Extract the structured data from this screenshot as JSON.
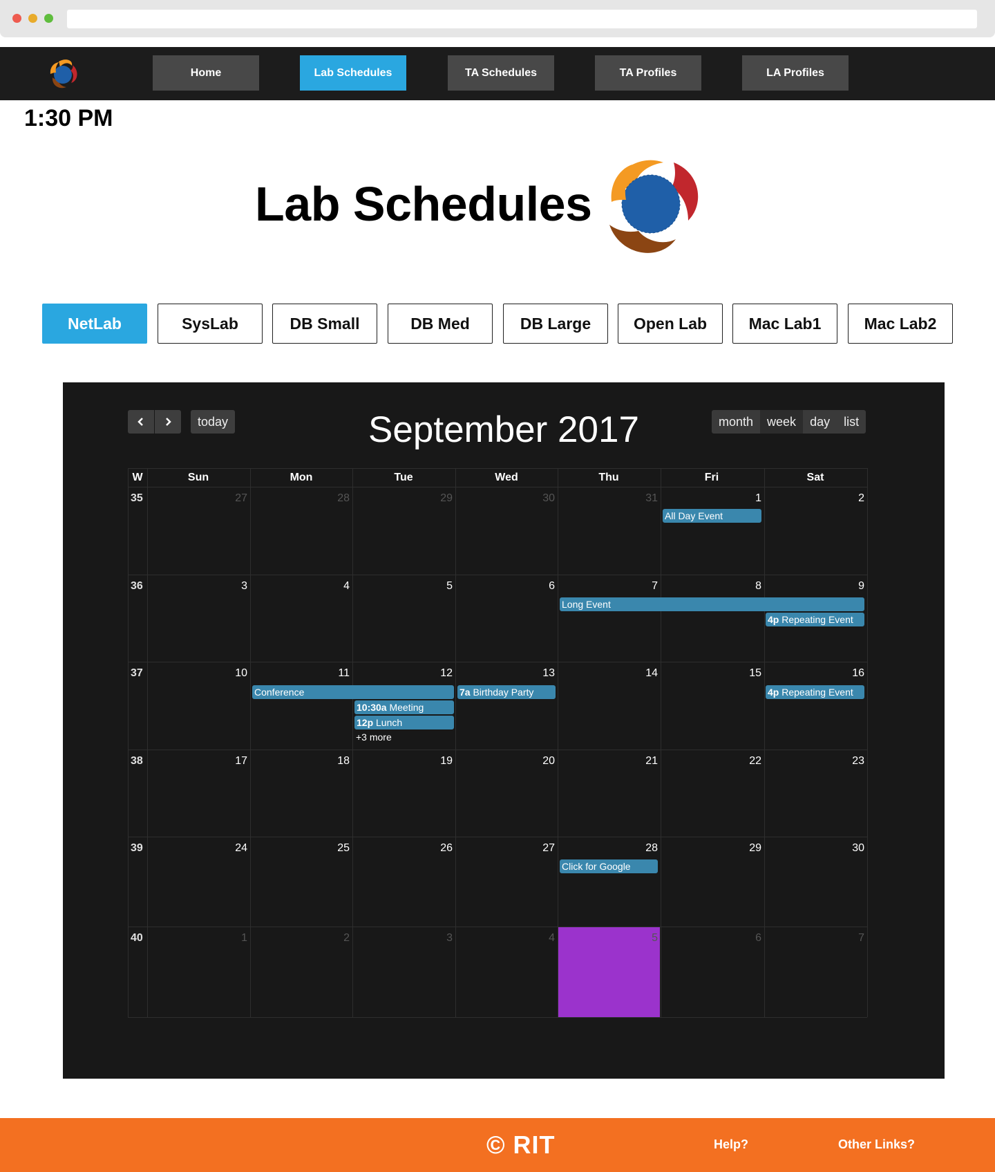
{
  "nav": {
    "items": [
      {
        "label": "Home"
      },
      {
        "label": "Lab Schedules"
      },
      {
        "label": "TA Schedules"
      },
      {
        "label": "TA Profiles"
      },
      {
        "label": "LA Profiles"
      }
    ],
    "active_index": 1
  },
  "clock": "1:30 PM",
  "page_title": "Lab Schedules",
  "labs": {
    "items": [
      {
        "label": "NetLab"
      },
      {
        "label": "SysLab"
      },
      {
        "label": "DB Small"
      },
      {
        "label": "DB Med"
      },
      {
        "label": "DB Large"
      },
      {
        "label": "Open Lab"
      },
      {
        "label": "Mac Lab1"
      },
      {
        "label": "Mac Lab2"
      }
    ],
    "active_index": 0
  },
  "calendar": {
    "prev_icon": "chevron-left-icon",
    "next_icon": "chevron-right-icon",
    "today_label": "today",
    "title": "September 2017",
    "views": [
      {
        "label": "month"
      },
      {
        "label": "week"
      },
      {
        "label": "day"
      },
      {
        "label": "list"
      }
    ],
    "active_view": "week",
    "week_header": "W",
    "day_headers": [
      "Sun",
      "Mon",
      "Tue",
      "Wed",
      "Thu",
      "Fri",
      "Sat"
    ],
    "weeks": [
      {
        "num": "35",
        "days": [
          "27",
          "28",
          "29",
          "30",
          "31",
          "1",
          "2"
        ]
      },
      {
        "num": "36",
        "days": [
          "3",
          "4",
          "5",
          "6",
          "7",
          "8",
          "9"
        ]
      },
      {
        "num": "37",
        "days": [
          "10",
          "11",
          "12",
          "13",
          "14",
          "15",
          "16"
        ]
      },
      {
        "num": "38",
        "days": [
          "17",
          "18",
          "19",
          "20",
          "21",
          "22",
          "23"
        ]
      },
      {
        "num": "39",
        "days": [
          "24",
          "25",
          "26",
          "27",
          "28",
          "29",
          "30"
        ]
      },
      {
        "num": "40",
        "days": [
          "1",
          "2",
          "3",
          "4",
          "5",
          "6",
          "7"
        ]
      }
    ],
    "events": [
      {
        "time": "",
        "title": "All Day Event"
      },
      {
        "time": "",
        "title": "Long Event"
      },
      {
        "time": "4p",
        "title": " Repeating Event"
      },
      {
        "time": "",
        "title": "Conference"
      },
      {
        "time": "10:30a",
        "title": " Meeting"
      },
      {
        "time": "12p",
        "title": " Lunch"
      },
      {
        "time": "7a",
        "title": " Birthday Party"
      },
      {
        "time": "4p",
        "title": " Repeating Event"
      },
      {
        "time": "",
        "title": "Click for Google"
      }
    ],
    "more_link": "+3 more",
    "event_color": "#3a87ad",
    "today_color": "#9b33cc"
  },
  "footer": {
    "copyright": "© RIT",
    "help": "Help?",
    "other_links": "Other Links?"
  },
  "colors": {
    "accent": "#2aa7e0",
    "footer": "#f37021",
    "nav": "#1c1c1c"
  }
}
